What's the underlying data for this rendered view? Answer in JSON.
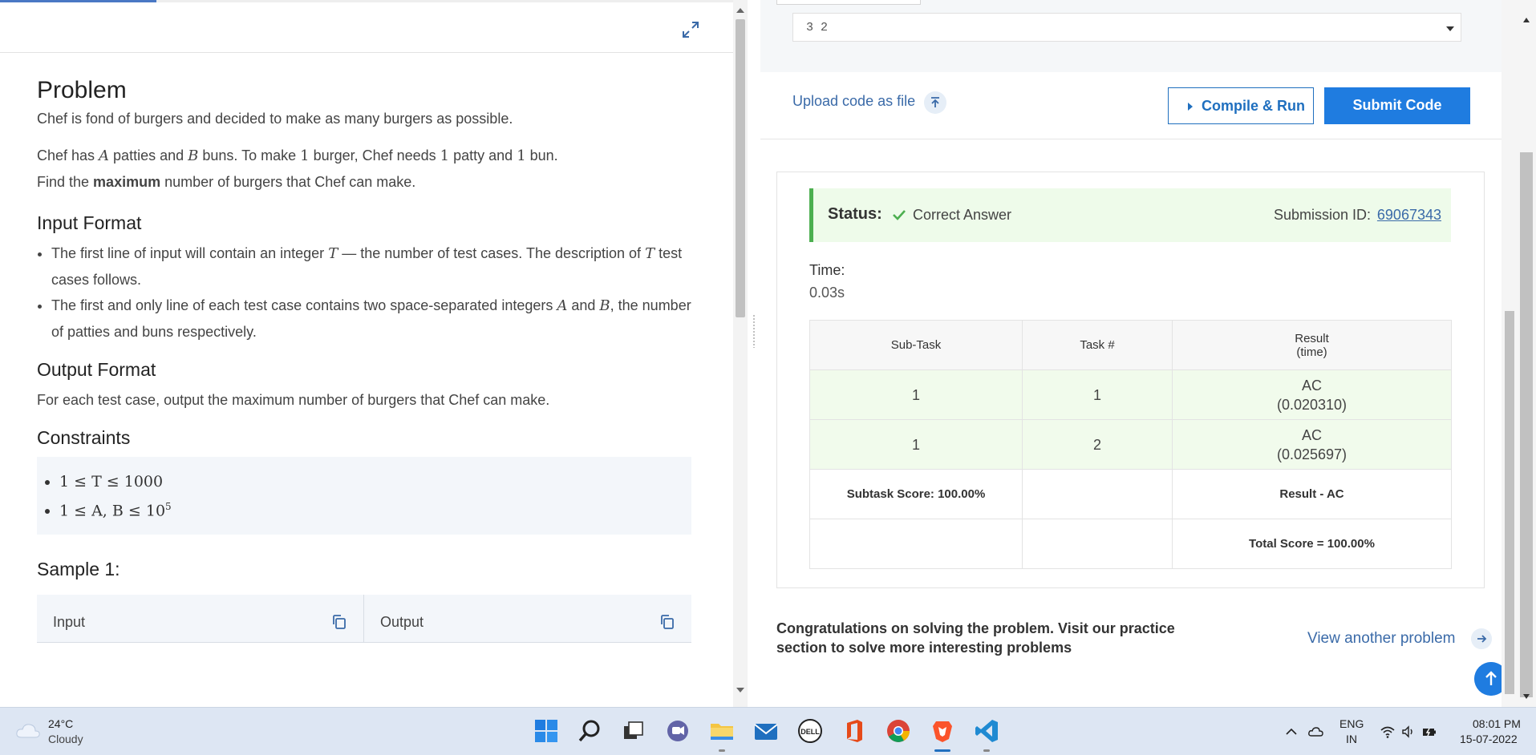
{
  "problem": {
    "title": "Problem",
    "intro": "Chef is fond of burgers and decided to make as many burgers as possible.",
    "line2_a": "Chef has ",
    "var_A": "A",
    "line2_b": " patties and ",
    "var_B": "B",
    "line2_c": " buns. To make ",
    "one1": "1",
    "line2_d": " burger, Chef needs ",
    "one2": "1",
    "line2_e": " patty and ",
    "one3": "1",
    "line2_f": " bun.",
    "line3_a": "Find the ",
    "line3_bold": "maximum",
    "line3_b": " number of burgers that Chef can make."
  },
  "input_format": {
    "heading": "Input Format",
    "item1_a": "The first line of input will contain an integer ",
    "item1_var": "T",
    "item1_b": " — the number of test cases. The description of ",
    "item1_var2": "T",
    "item1_c": " test cases follows.",
    "item2_a": "The first and only line of each test case contains two space-separated integers ",
    "item2_var1": "A",
    "item2_b": " and ",
    "item2_var2": "B",
    "item2_c": ", the number of patties and buns respectively."
  },
  "output_format": {
    "heading": "Output Format",
    "text": "For each test case, output the maximum number of burgers that Chef can make."
  },
  "constraints": {
    "heading": "Constraints",
    "c1": "1 ≤ T ≤ 1000",
    "c2_base": "1 ≤ A, B ≤ 10",
    "c2_exp": "5"
  },
  "sample": {
    "heading": "Sample 1:",
    "input_label": "Input",
    "output_label": "Output"
  },
  "editor": {
    "custom_input": "3 2"
  },
  "actions": {
    "upload_label": "Upload code as file",
    "compile_label": "Compile & Run",
    "submit_label": "Submit Code"
  },
  "result": {
    "status_label": "Status:",
    "status_value": "Correct Answer",
    "submission_label": "Submission ID:",
    "submission_id": "69067343",
    "time_label": "Time:",
    "time_value": "0.03s",
    "headers": {
      "subtask": "Sub-Task",
      "task": "Task #",
      "result_line1": "Result",
      "result_line2": "(time)"
    },
    "rows": [
      {
        "subtask": "1",
        "task": "1",
        "verdict": "AC",
        "time": "(0.020310)"
      },
      {
        "subtask": "1",
        "task": "2",
        "verdict": "AC",
        "time": "(0.025697)"
      }
    ],
    "subtask_score": "Subtask Score: 100.00%",
    "result_summary": "Result - AC",
    "total_score": "Total Score = 100.00%"
  },
  "footer": {
    "congrats_line1": "Congratulations on solving the problem. Visit our practice",
    "congrats_line2": "section to solve more interesting problems",
    "view_another": "View another problem"
  },
  "taskbar": {
    "weather_temp": "24°C",
    "weather_desc": "Cloudy",
    "lang_top": "ENG",
    "lang_bottom": "IN",
    "time": "08:01 PM",
    "date": "15-07-2022"
  },
  "colors": {
    "accent": "#1f7ce0",
    "link": "#3a6aa8",
    "success": "#4caf50",
    "success_bg": "#eefbea"
  }
}
